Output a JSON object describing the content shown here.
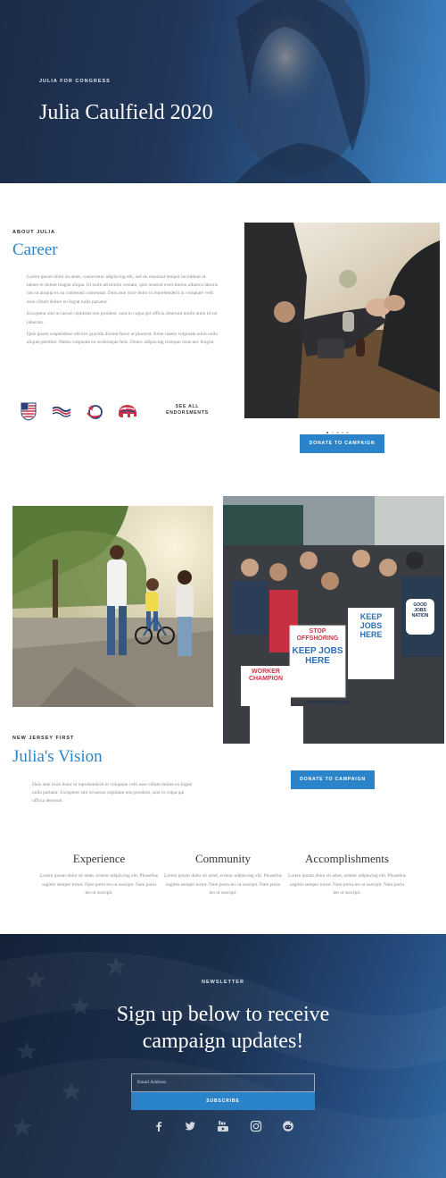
{
  "hero": {
    "eyebrow": "JULIA FOR CONGRESS",
    "title": "Julia Caulfield 2020"
  },
  "about": {
    "eyebrow": "ABOUT JULIA",
    "title": "Career",
    "paragraphs": [
      "Lorem ipsum dolor sit amet, consectetur adipiscing elit, sed do eiusmod tempor incididunt ut labore et dolore magna aliqua. Ut enim ad minim veniam, quis nostrud exercitation ullamco laboris nisi ut aliquip ex ea commodo consequat. Duis aute irure dolor in reprehenderit in voluptate velit esse cillum dolore eu fugiat nulla pariatur.",
      "Excepteur sint occaecat cupidatat non proident, sunt in culpa qui officia deserunt mollit anim id est laborum.",
      "Quis ipsum suspendisse ultrices gravida dictum fusce ut placerat. Amet mattis vulputate enim nulla aliquet porttitor. Metus vulputate eu scelerisque felis. Donec adipiscing tristique risus nec feugiat."
    ],
    "endorsement_icons": [
      "flag-shield-icon",
      "waving-flag-icon",
      "star-swirl-icon",
      "elephant-icon"
    ],
    "see_all": "SEE ALL ENDORSMENTS",
    "donate": "DONATE TO CAMPAIGN",
    "carousel_active": 1
  },
  "vision": {
    "eyebrow": "NEW JERSEY FIRST",
    "title": "Julia's Vision",
    "text": "Duis aute irure dolor in reprehenderit in voluptate velit esse cillum dolore eu fugiat nulla pariatur. Excepteur sint occaecat cupidatat non proident, sunt in culpa qui officia deserunt.",
    "donate": "DONATE TO CAMPAIGN",
    "signs": [
      "STOP OFFSHORING",
      "KEEP JOBS HERE",
      "WORKER CHAMPION",
      "GOOD JOBS NATION",
      "GOODJOBSNATION.ORG"
    ]
  },
  "features": [
    {
      "title": "Experience",
      "text": "Lorem ipsum dolor sit amet, ectetur adipiscing elit. Phasellus sagittis semper tortor. Nam porta leo ut suscipit. Nam porta leo ut suscipit."
    },
    {
      "title": "Community",
      "text": "Lorem ipsum dolor sit amet, ectetur adipiscing elit. Phasellus sagittis semper tortor. Nam porta leo ut suscipit. Nam porta leo ut suscipit."
    },
    {
      "title": "Accomplishments",
      "text": "Lorem ipsum dolor sit amet, ectetur adipiscing elit. Phasellus sagittis semper tortor. Nam porta leo ut suscipit. Nam porta leo ut suscipit."
    }
  ],
  "newsletter": {
    "eyebrow": "NEWSLETTER",
    "title": "Sign up below to receive campaign updates!",
    "email_placeholder": "Email Address",
    "subscribe": "SUBSCRIBE",
    "social_icons": [
      "facebook-icon",
      "twitter-icon",
      "youtube-icon",
      "instagram-icon",
      "reddit-icon"
    ]
  },
  "colors": {
    "accent": "#2b84c9",
    "hero_dark": "#1c2c48",
    "footer_dark": "#142238"
  }
}
